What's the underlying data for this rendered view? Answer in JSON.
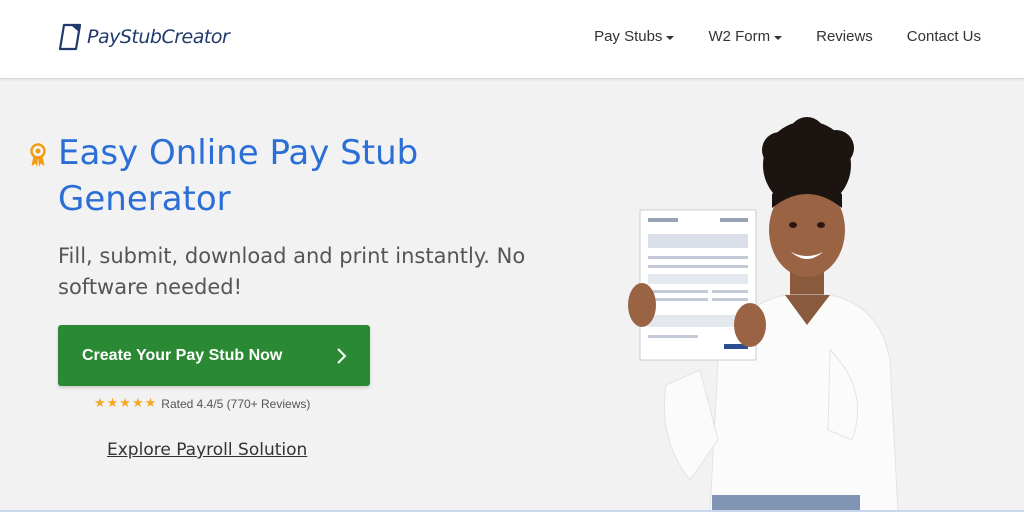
{
  "header": {
    "logo": {
      "part1": "PayStub",
      "part2": "Creator"
    },
    "nav": [
      {
        "label": "Pay Stubs",
        "has_dropdown": true
      },
      {
        "label": "W2 Form",
        "has_dropdown": true
      },
      {
        "label": "Reviews",
        "has_dropdown": false
      },
      {
        "label": "Contact Us",
        "has_dropdown": false
      }
    ]
  },
  "hero": {
    "badge_icon": "award-ribbon-icon",
    "title": "Easy Online Pay Stub Generator",
    "subtitle": "Fill, submit, download and print instantly. No software needed!",
    "cta_label": "Create Your Pay Stub Now",
    "rating": {
      "stars": 5,
      "stars_text": "★★★★★",
      "text": "Rated 4.4/5 (770+ Reviews)"
    },
    "explore_label": "Explore Payroll Solution"
  },
  "colors": {
    "accent_blue": "#2b6fd6",
    "cta_green": "#2a8a34",
    "star_orange": "#f6a823",
    "badge_orange": "#f39c12",
    "background": "#f2f2f3"
  }
}
